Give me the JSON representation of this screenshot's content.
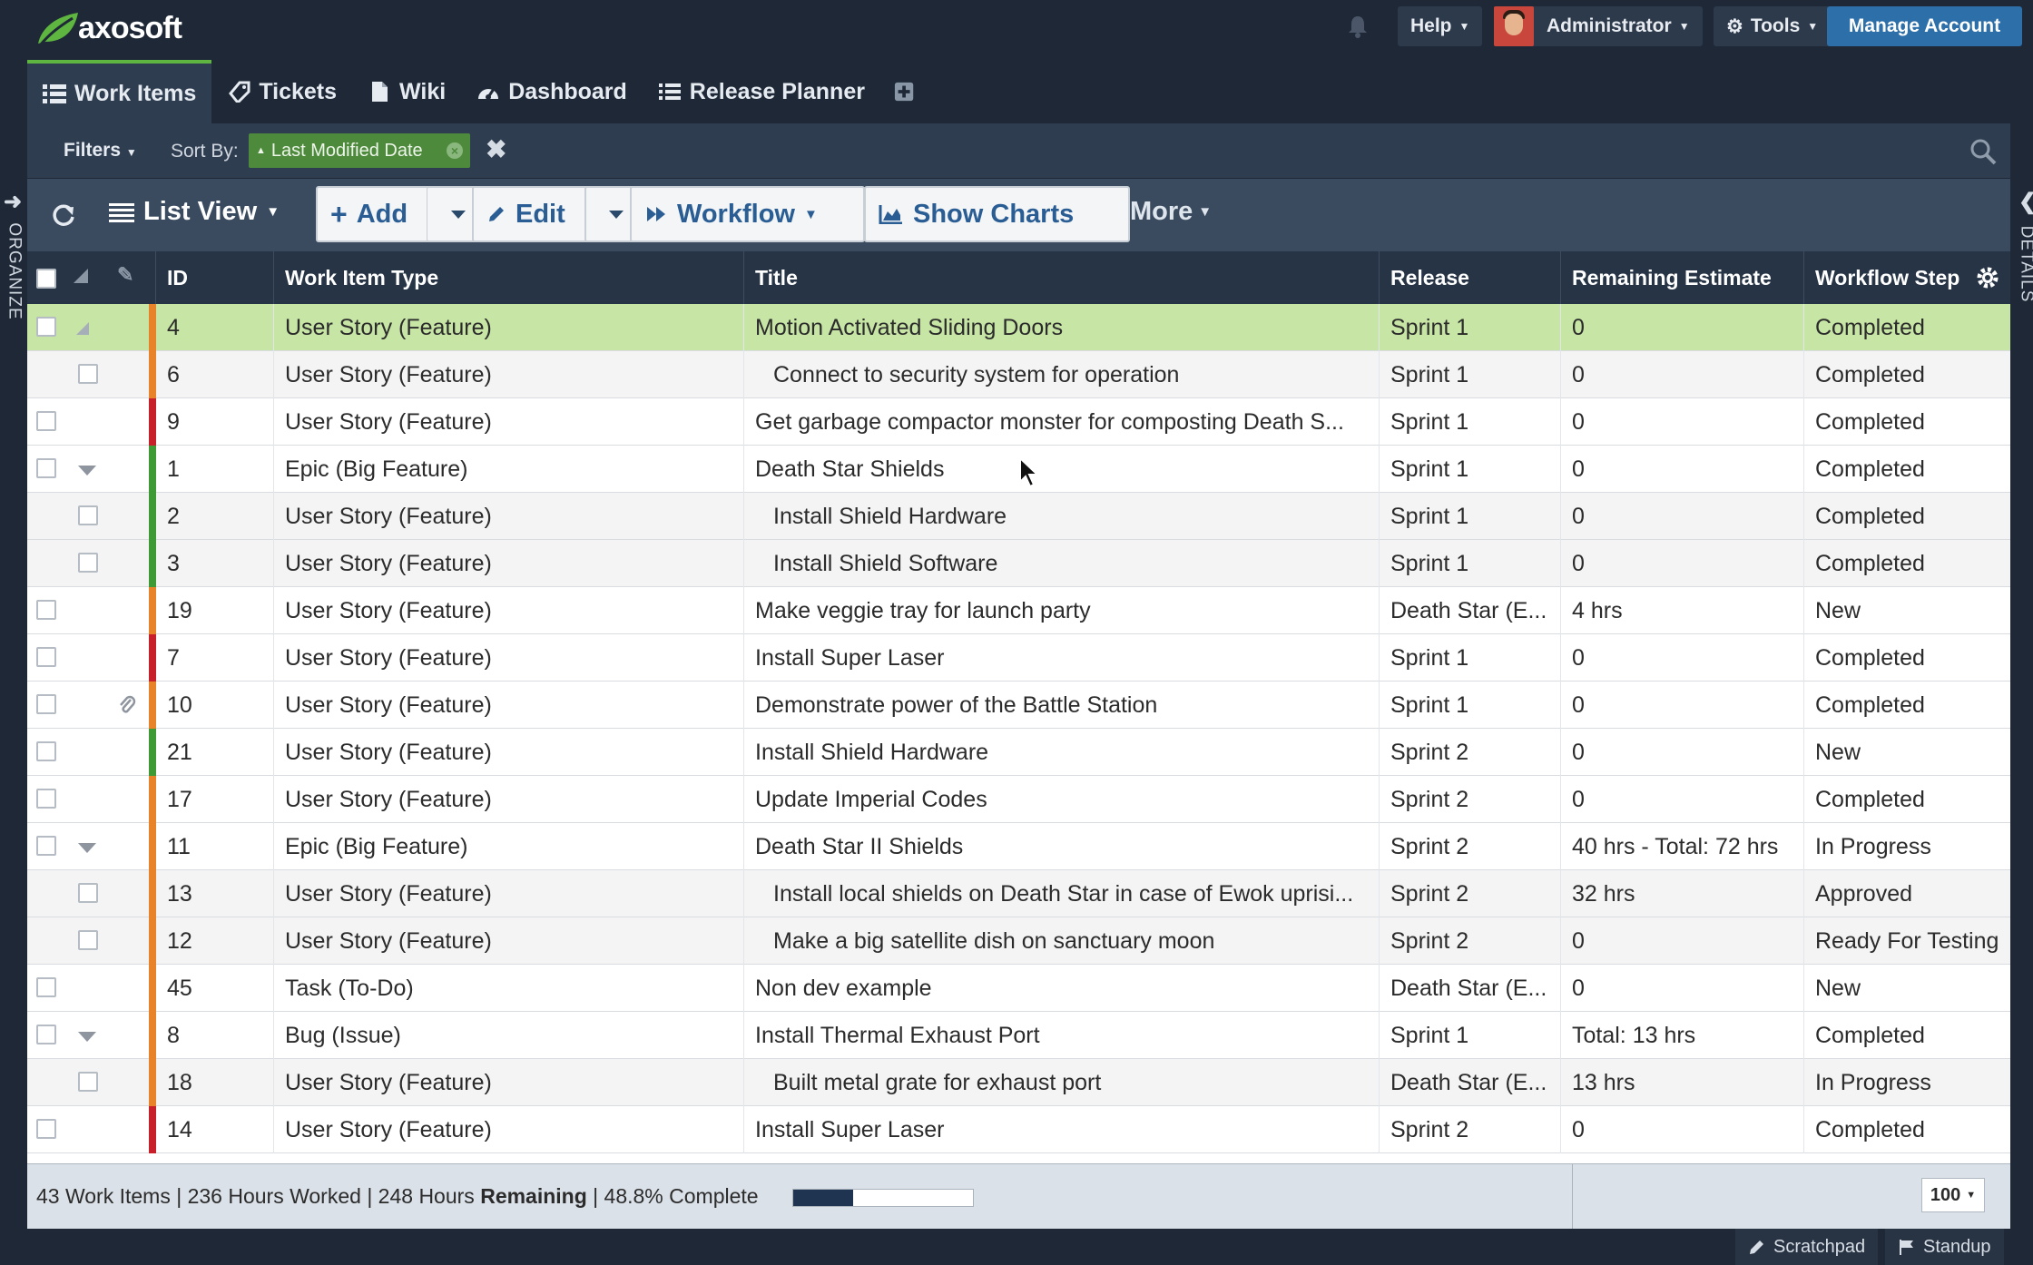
{
  "app": {
    "logo_text": "axosoft",
    "help_label": "Help",
    "user_label": "Administrator",
    "tools_label": "Tools",
    "manage_account_label": "Manage Account"
  },
  "nav_tabs": [
    {
      "label": "Work Items",
      "icon": "list-icon",
      "active": true
    },
    {
      "label": "Tickets",
      "icon": "tag-icon",
      "active": false
    },
    {
      "label": "Wiki",
      "icon": "document-icon",
      "active": false
    },
    {
      "label": "Dashboard",
      "icon": "gauge-icon",
      "active": false
    },
    {
      "label": "Release Planner",
      "icon": "planner-icon",
      "active": false
    }
  ],
  "side": {
    "left_label": "ORGANIZE",
    "right_label": "DETAILS"
  },
  "filterbar": {
    "filters_label": "Filters",
    "sort_by_label": "Sort By:",
    "sort_chip_label": "Last Modified Date"
  },
  "toolbar": {
    "list_view_label": "List View",
    "add_label": "Add",
    "edit_label": "Edit",
    "workflow_label": "Workflow",
    "show_charts_label": "Show Charts",
    "more_label": "More"
  },
  "grid": {
    "headers": {
      "id": "ID",
      "type": "Work Item Type",
      "title": "Title",
      "release": "Release",
      "remaining": "Remaining Estimate",
      "workflow": "Workflow Step"
    },
    "rows": [
      {
        "id": "4",
        "type": "User Story (Feature)",
        "title": "Motion Activated Sliding Doors",
        "release": "Sprint 1",
        "remaining": "0",
        "workflow": "Completed",
        "color": "#e8832a",
        "level": 0,
        "selected": true,
        "expander": false,
        "attachment": false
      },
      {
        "id": "6",
        "type": "User Story (Feature)",
        "title": "Connect to security system for operation",
        "release": "Sprint 1",
        "remaining": "0",
        "workflow": "Completed",
        "color": "#e8832a",
        "level": 1,
        "selected": false,
        "expander": false,
        "attachment": false
      },
      {
        "id": "9",
        "type": "User Story (Feature)",
        "title": "Get garbage compactor monster for composting Death S...",
        "release": "Sprint 1",
        "remaining": "0",
        "workflow": "Completed",
        "color": "#c8202a",
        "level": 0,
        "selected": false,
        "expander": false,
        "attachment": false
      },
      {
        "id": "1",
        "type": "Epic (Big Feature)",
        "title": "Death Star Shields",
        "release": "Sprint 1",
        "remaining": "0",
        "workflow": "Completed",
        "color": "#3e9a34",
        "level": 0,
        "selected": false,
        "expander": true,
        "attachment": false
      },
      {
        "id": "2",
        "type": "User Story (Feature)",
        "title": "Install Shield Hardware",
        "release": "Sprint 1",
        "remaining": "0",
        "workflow": "Completed",
        "color": "#3e9a34",
        "level": 1,
        "selected": false,
        "expander": false,
        "attachment": false
      },
      {
        "id": "3",
        "type": "User Story (Feature)",
        "title": "Install Shield Software",
        "release": "Sprint 1",
        "remaining": "0",
        "workflow": "Completed",
        "color": "#3e9a34",
        "level": 1,
        "selected": false,
        "expander": false,
        "attachment": false
      },
      {
        "id": "19",
        "type": "User Story (Feature)",
        "title": "Make veggie tray for launch party",
        "release": "Death Star (E...",
        "remaining": "4 hrs",
        "workflow": "New",
        "color": "#e8832a",
        "level": 0,
        "selected": false,
        "expander": false,
        "attachment": false
      },
      {
        "id": "7",
        "type": "User Story (Feature)",
        "title": "Install Super Laser",
        "release": "Sprint 1",
        "remaining": "0",
        "workflow": "Completed",
        "color": "#c8202a",
        "level": 0,
        "selected": false,
        "expander": false,
        "attachment": false
      },
      {
        "id": "10",
        "type": "User Story (Feature)",
        "title": "Demonstrate power of the Battle Station",
        "release": "Sprint 1",
        "remaining": "0",
        "workflow": "Completed",
        "color": "#e8832a",
        "level": 0,
        "selected": false,
        "expander": false,
        "attachment": true
      },
      {
        "id": "21",
        "type": "User Story (Feature)",
        "title": "Install Shield Hardware",
        "release": "Sprint 2",
        "remaining": "0",
        "workflow": "New",
        "color": "#3e9a34",
        "level": 0,
        "selected": false,
        "expander": false,
        "attachment": false
      },
      {
        "id": "17",
        "type": "User Story (Feature)",
        "title": "Update Imperial Codes",
        "release": "Sprint 2",
        "remaining": "0",
        "workflow": "Completed",
        "color": "#e8832a",
        "level": 0,
        "selected": false,
        "expander": false,
        "attachment": false
      },
      {
        "id": "11",
        "type": "Epic (Big Feature)",
        "title": "Death Star II Shields",
        "release": "Sprint 2",
        "remaining": "40 hrs - Total: 72 hrs",
        "workflow": "In Progress",
        "color": "#e8832a",
        "level": 0,
        "selected": false,
        "expander": true,
        "attachment": false
      },
      {
        "id": "13",
        "type": "User Story (Feature)",
        "title": "Install local shields on Death Star in case of Ewok uprisi...",
        "release": "Sprint 2",
        "remaining": "32 hrs",
        "workflow": "Approved",
        "color": "#e8832a",
        "level": 1,
        "selected": false,
        "expander": false,
        "attachment": false
      },
      {
        "id": "12",
        "type": "User Story (Feature)",
        "title": "Make a big satellite dish on sanctuary moon",
        "release": "Sprint 2",
        "remaining": "0",
        "workflow": "Ready For Testing",
        "color": "#e8832a",
        "level": 1,
        "selected": false,
        "expander": false,
        "attachment": false
      },
      {
        "id": "45",
        "type": "Task (To-Do)",
        "title": "Non dev example",
        "release": "Death Star (E...",
        "remaining": "0",
        "workflow": "New",
        "color": "#e8832a",
        "level": 0,
        "selected": false,
        "expander": false,
        "attachment": false
      },
      {
        "id": "8",
        "type": "Bug (Issue)",
        "title": "Install Thermal Exhaust Port",
        "release": "Sprint 1",
        "remaining": "Total: 13 hrs",
        "workflow": "Completed",
        "color": "#e8832a",
        "level": 0,
        "selected": false,
        "expander": true,
        "attachment": false
      },
      {
        "id": "18",
        "type": "User Story (Feature)",
        "title": "Built metal grate for exhaust port",
        "release": "Death Star (E...",
        "remaining": "13 hrs",
        "workflow": "In Progress",
        "color": "#e8832a",
        "level": 1,
        "selected": false,
        "expander": false,
        "attachment": false
      },
      {
        "id": "14",
        "type": "User Story (Feature)",
        "title": "Install Super Laser",
        "release": "Sprint 2",
        "remaining": "0",
        "workflow": "Completed",
        "color": "#c8202a",
        "level": 0,
        "selected": false,
        "expander": false,
        "attachment": false
      }
    ]
  },
  "footer": {
    "items_text": "43 Work Items | 236 Hours Worked | 248 Hours",
    "remaining_bold": "Remaining",
    "complete_text": "| 48.8% Complete",
    "progress_fraction": 0.333,
    "per_page": "100"
  },
  "bottom": {
    "scratchpad_label": "Scratchpad",
    "standup_label": "Standup"
  },
  "colors": {
    "accent_green": "#5eb640",
    "selected_row": "#c7e5a5",
    "manage_blue": "#2d6fa8",
    "orange": "#e8832a",
    "red": "#c8202a",
    "green": "#3e9a34"
  }
}
